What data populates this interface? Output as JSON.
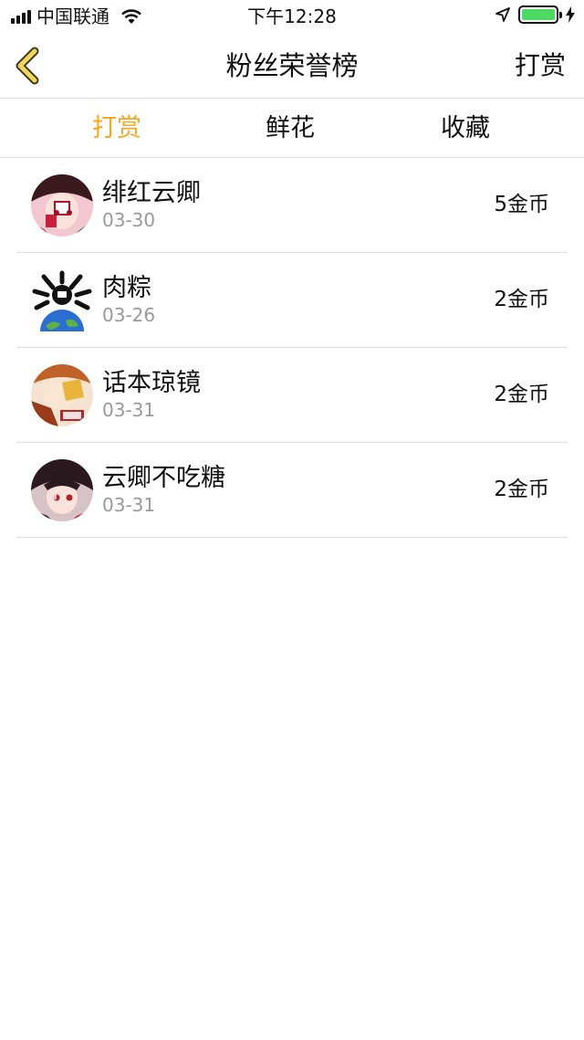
{
  "status_bar": {
    "carrier": "中国联通",
    "time": "下午12:28"
  },
  "nav": {
    "title": "粉丝荣誉榜",
    "right_action": "打赏"
  },
  "tabs": [
    {
      "label": "打赏",
      "active": true
    },
    {
      "label": "鲜花",
      "active": false
    },
    {
      "label": "收藏",
      "active": false
    }
  ],
  "colors": {
    "accent": "#f6a623",
    "battery": "#4cd964"
  },
  "list": [
    {
      "name": "绯红云卿",
      "date": "03-30",
      "amount": "5金币",
      "avatar_icon": "avatar-anime-red"
    },
    {
      "name": "肉粽",
      "date": "03-26",
      "amount": "2金币",
      "avatar_icon": "avatar-globe"
    },
    {
      "name": "话本琼镜",
      "date": "03-31",
      "amount": "2金币",
      "avatar_icon": "avatar-anime-orange"
    },
    {
      "name": "云卿不吃糖",
      "date": "03-31",
      "amount": "2金币",
      "avatar_icon": "avatar-anime-dark"
    }
  ]
}
